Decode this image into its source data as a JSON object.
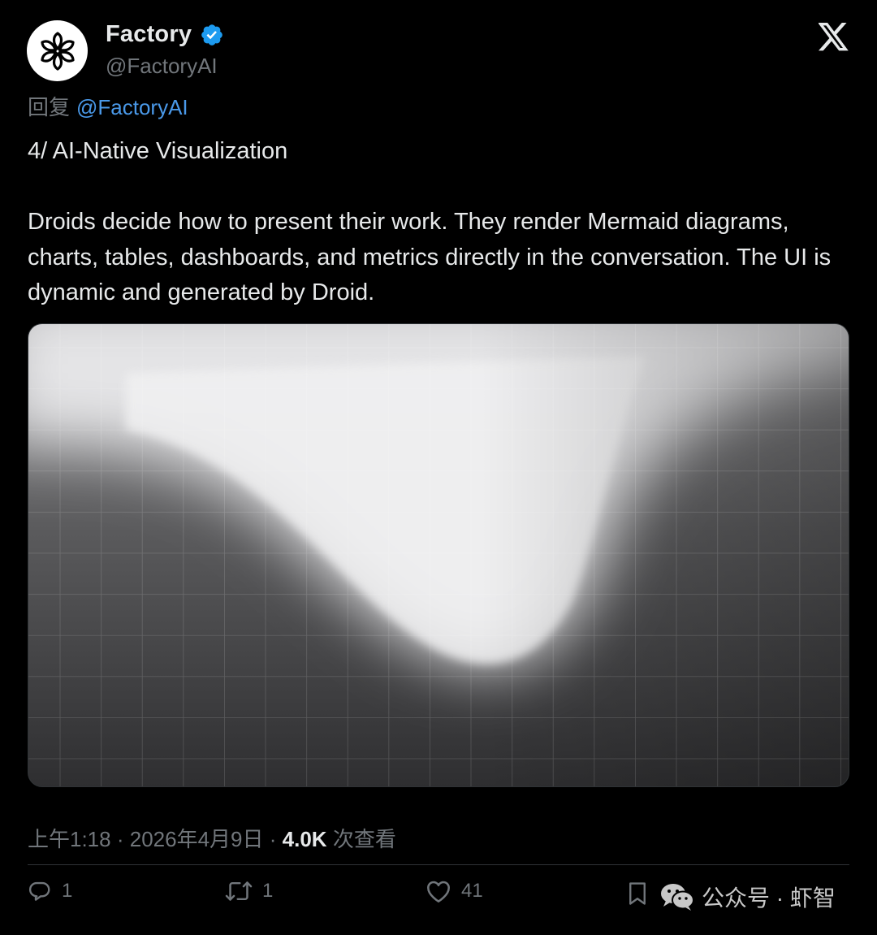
{
  "author": {
    "display_name": "Factory",
    "handle": "@FactoryAI",
    "avatar_icon": "factory-asterisk-logo",
    "verified_color": "#1d9bf0"
  },
  "reply": {
    "prefix": "回复",
    "mention": "@FactoryAI"
  },
  "tweet": {
    "heading": "4/ AI-Native Visualization",
    "body": "Droids decide how to present their work. They render Mermaid diagrams, charts, tables, dashboards, and metrics directly in the conversation. The UI is dynamic and generated by Droid."
  },
  "meta": {
    "time": "上午1:18",
    "separator": "·",
    "date": "2026年4月9日",
    "views_count": "4.0K",
    "views_label": "次查看"
  },
  "actions": {
    "replies": "1",
    "reposts": "1",
    "likes": "41"
  },
  "watermark": {
    "text": "公众号 · 虾智"
  },
  "colors": {
    "background": "#000000",
    "text": "#e7e9ea",
    "muted": "#71767b",
    "link": "#4a99e9",
    "divider": "#2f3336"
  }
}
